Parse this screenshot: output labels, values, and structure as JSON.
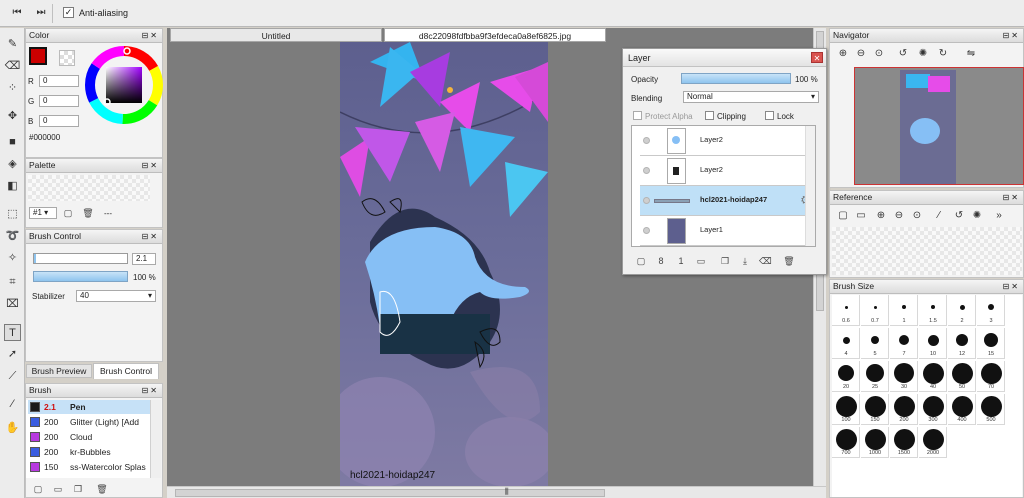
{
  "toolbar": {
    "antialias_label": "Anti-aliasing",
    "antialias_checked": "✓",
    "prev_icon": "◀◀",
    "next_icon": "▶▶"
  },
  "color_panel": {
    "title": "Color",
    "r_label": "R",
    "g_label": "G",
    "b_label": "B",
    "r": "0",
    "g": "0",
    "b": "0",
    "hex": "#000000",
    "fg": "#cc0000"
  },
  "palette_panel": {
    "title": "Palette",
    "select": "#1 ▾",
    "dash": "---"
  },
  "brush_control": {
    "title": "Brush Control",
    "size": "2.1",
    "opacity": "100 %",
    "stabilizer_label": "Stabilizer",
    "stabilizer_value": "40"
  },
  "brush_tabs": {
    "preview": "Brush Preview",
    "control": "Brush Control"
  },
  "brush_panel": {
    "title": "Brush",
    "items": [
      {
        "size": "2.1",
        "name": "Pen",
        "color": "#1a1a1a"
      },
      {
        "size": "200",
        "name": "Glitter (Light) [Add",
        "color": "#3a5de0"
      },
      {
        "size": "200",
        "name": "Cloud",
        "color": "#b83ae0"
      },
      {
        "size": "200",
        "name": "kr-Bubbles",
        "color": "#3a5de0"
      },
      {
        "size": "150",
        "name": "ss-Watercolor Splas",
        "color": "#b83ae0"
      }
    ]
  },
  "tabs": {
    "untitled": "Untitled",
    "file": "d8c22098fdfbba9f3efdeca0a8ef6825.jpg"
  },
  "artwork": {
    "watermark": "hcl2021-hoidap247"
  },
  "layer_window": {
    "title": "Layer",
    "opacity_label": "Opacity",
    "opacity_value": "100 %",
    "blending_label": "Blending",
    "blending_value": "Normal",
    "protect_alpha": "Protect Alpha",
    "clipping": "Clipping",
    "lock": "Lock",
    "layers": [
      {
        "name": "Layer2"
      },
      {
        "name": "Layer2"
      },
      {
        "name": "hcl2021-hoidap247"
      },
      {
        "name": "Layer1"
      }
    ]
  },
  "navigator": {
    "title": "Navigator"
  },
  "reference": {
    "title": "Reference"
  },
  "brush_size": {
    "title": "Brush Size",
    "sizes": [
      "0.6",
      "0.7",
      "1",
      "1.5",
      "2",
      "3",
      "4",
      "5",
      "7",
      "10",
      "12",
      "15",
      "20",
      "25",
      "30",
      "40",
      "50",
      "70",
      "100",
      "150",
      "200",
      "300",
      "400",
      "500",
      "700",
      "1000",
      "1500",
      "2000"
    ]
  }
}
